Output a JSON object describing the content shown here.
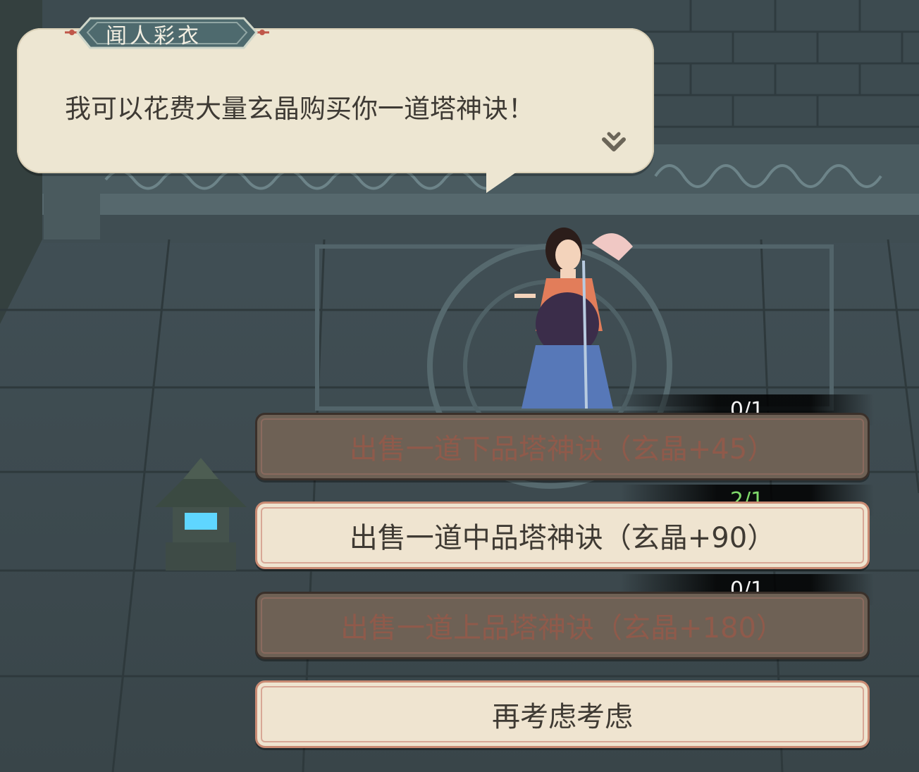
{
  "dialogue": {
    "speaker": "闻人彩衣",
    "text": "我可以花费大量玄晶购买你一道塔神诀！",
    "continue_icon": "down-chevron-continue-icon"
  },
  "options": [
    {
      "label": "出售一道下品塔神诀（玄晶+45）",
      "progress": "0/1",
      "progress_color": "#f4f4f4",
      "enabled": false
    },
    {
      "label": "出售一道中品塔神诀（玄晶+90）",
      "progress": "2/1",
      "progress_color": "#7fd96a",
      "enabled": true
    },
    {
      "label": "出售一道上品塔神诀（玄晶+180）",
      "progress": "0/1",
      "progress_color": "#f4f4f4",
      "enabled": false
    },
    {
      "label": "再考虑考虑",
      "enabled": true
    }
  ],
  "colors": {
    "dialogue_bg": "#ede6d2",
    "option_enabled_bg": "#efe4d0",
    "option_disabled_bg": "#6e6155",
    "name_plate": "#4e6a6e"
  }
}
